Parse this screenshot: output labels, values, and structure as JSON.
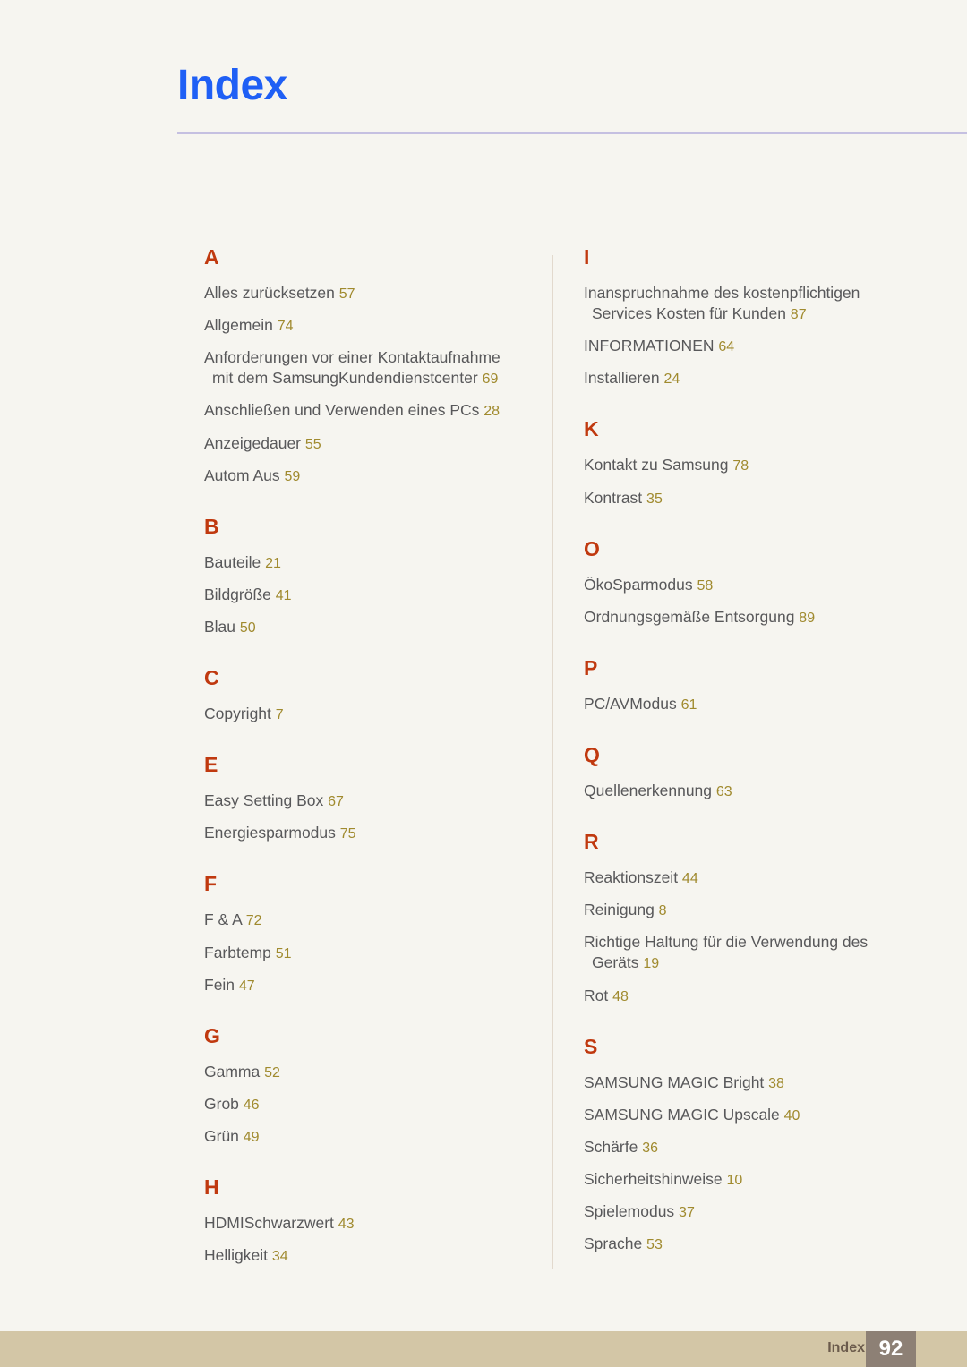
{
  "header": {
    "title": "Index"
  },
  "columns": [
    {
      "side": "left",
      "groups": [
        {
          "letter": "A",
          "entries": [
            {
              "text": "Alles zurücksetzen",
              "page": "57"
            },
            {
              "text": "Allgemein",
              "page": "74"
            },
            {
              "text": "Anforderungen vor einer Kontaktaufnahme mit dem SamsungKundendienstcenter",
              "page": "69"
            },
            {
              "text": "Anschließen und Verwenden eines PCs",
              "page": "28"
            },
            {
              "text": "Anzeigedauer",
              "page": "55"
            },
            {
              "text": "Autom Aus",
              "page": "59"
            }
          ]
        },
        {
          "letter": "B",
          "entries": [
            {
              "text": "Bauteile",
              "page": "21"
            },
            {
              "text": "Bildgröße",
              "page": "41"
            },
            {
              "text": "Blau",
              "page": "50"
            }
          ]
        },
        {
          "letter": "C",
          "entries": [
            {
              "text": "Copyright",
              "page": "7"
            }
          ]
        },
        {
          "letter": "E",
          "entries": [
            {
              "text": "Easy Setting Box",
              "page": "67"
            },
            {
              "text": "Energiesparmodus",
              "page": "75"
            }
          ]
        },
        {
          "letter": "F",
          "entries": [
            {
              "text": "F & A",
              "page": "72"
            },
            {
              "text": "Farbtemp",
              "page": "51"
            },
            {
              "text": "Fein",
              "page": "47"
            }
          ]
        },
        {
          "letter": "G",
          "entries": [
            {
              "text": "Gamma",
              "page": "52"
            },
            {
              "text": "Grob",
              "page": "46"
            },
            {
              "text": "Grün",
              "page": "49"
            }
          ]
        },
        {
          "letter": "H",
          "entries": [
            {
              "text": "HDMISchwarzwert",
              "page": "43"
            },
            {
              "text": "Helligkeit",
              "page": "34"
            }
          ]
        }
      ]
    },
    {
      "side": "right",
      "groups": [
        {
          "letter": "I",
          "entries": [
            {
              "text": "Inanspruchnahme des kostenpflichtigen Services Kosten für Kunden",
              "page": "87"
            },
            {
              "text": "INFORMATIONEN",
              "page": "64"
            },
            {
              "text": "Installieren",
              "page": "24"
            }
          ]
        },
        {
          "letter": "K",
          "entries": [
            {
              "text": "Kontakt zu Samsung",
              "page": "78"
            },
            {
              "text": "Kontrast",
              "page": "35"
            }
          ]
        },
        {
          "letter": "O",
          "entries": [
            {
              "text": "ÖkoSparmodus",
              "page": "58"
            },
            {
              "text": "Ordnungsgemäße Entsorgung",
              "page": "89"
            }
          ]
        },
        {
          "letter": "P",
          "entries": [
            {
              "text": "PC/AVModus",
              "page": "61"
            }
          ]
        },
        {
          "letter": "Q",
          "entries": [
            {
              "text": "Quellenerkennung",
              "page": "63"
            }
          ]
        },
        {
          "letter": "R",
          "entries": [
            {
              "text": "Reaktionszeit",
              "page": "44"
            },
            {
              "text": "Reinigung",
              "page": "8"
            },
            {
              "text": "Richtige Haltung für die Verwendung des Geräts",
              "page": "19"
            },
            {
              "text": "Rot",
              "page": "48"
            }
          ]
        },
        {
          "letter": "S",
          "entries": [
            {
              "text": "SAMSUNG MAGIC Bright",
              "page": "38"
            },
            {
              "text": "SAMSUNG MAGIC Upscale",
              "page": "40"
            },
            {
              "text": "Schärfe",
              "page": "36"
            },
            {
              "text": "Sicherheitshinweise",
              "page": "10"
            },
            {
              "text": "Spielemodus",
              "page": "37"
            },
            {
              "text": "Sprache",
              "page": "53"
            }
          ]
        }
      ]
    }
  ],
  "footer": {
    "label": "Index",
    "page_number": "92"
  },
  "colors": {
    "background": "#f6f5f0",
    "title": "#1f5ff5",
    "group_letter": "#c0390f",
    "entry_text": "#58585a",
    "page_number": "#a08a2e",
    "header_rule": "#bcb6de",
    "column_divider": "#e2d9cd",
    "footer_bar": "#d3c6a6",
    "footer_label": "#6b5b4c",
    "footer_page_box": "#8d8075"
  }
}
